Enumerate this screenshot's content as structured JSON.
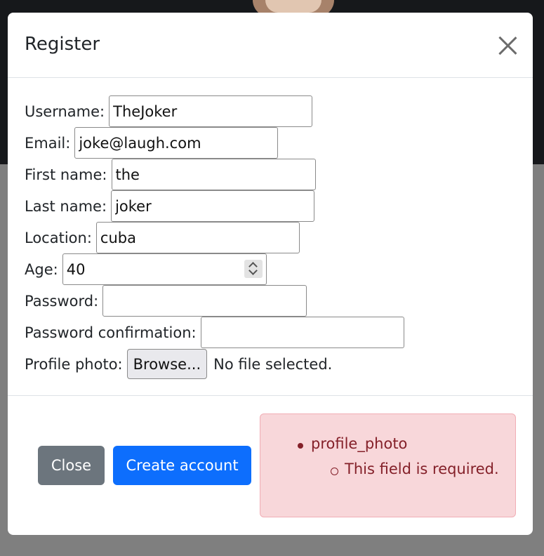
{
  "modal": {
    "title": "Register"
  },
  "form": {
    "username": {
      "label": "Username:",
      "value": "TheJoker"
    },
    "email": {
      "label": "Email:",
      "value": "joke@laugh.com"
    },
    "first_name": {
      "label": "First name:",
      "value": "the"
    },
    "last_name": {
      "label": "Last name:",
      "value": "joker"
    },
    "location": {
      "label": "Location:",
      "value": "cuba"
    },
    "age": {
      "label": "Age:",
      "value": "40"
    },
    "password": {
      "label": "Password:",
      "value": ""
    },
    "password_confirmation": {
      "label": "Password confirmation:",
      "value": ""
    },
    "profile_photo": {
      "label": "Profile photo:",
      "button": "Browse...",
      "status": "No file selected."
    }
  },
  "footer": {
    "close_label": "Close",
    "create_label": "Create account"
  },
  "errors": {
    "field": "profile_photo",
    "message": "This field is required."
  },
  "colors": {
    "primary": "#0d6efd",
    "secondary": "#6c757d",
    "danger_bg": "#f8d7da",
    "danger_text": "#842029"
  }
}
